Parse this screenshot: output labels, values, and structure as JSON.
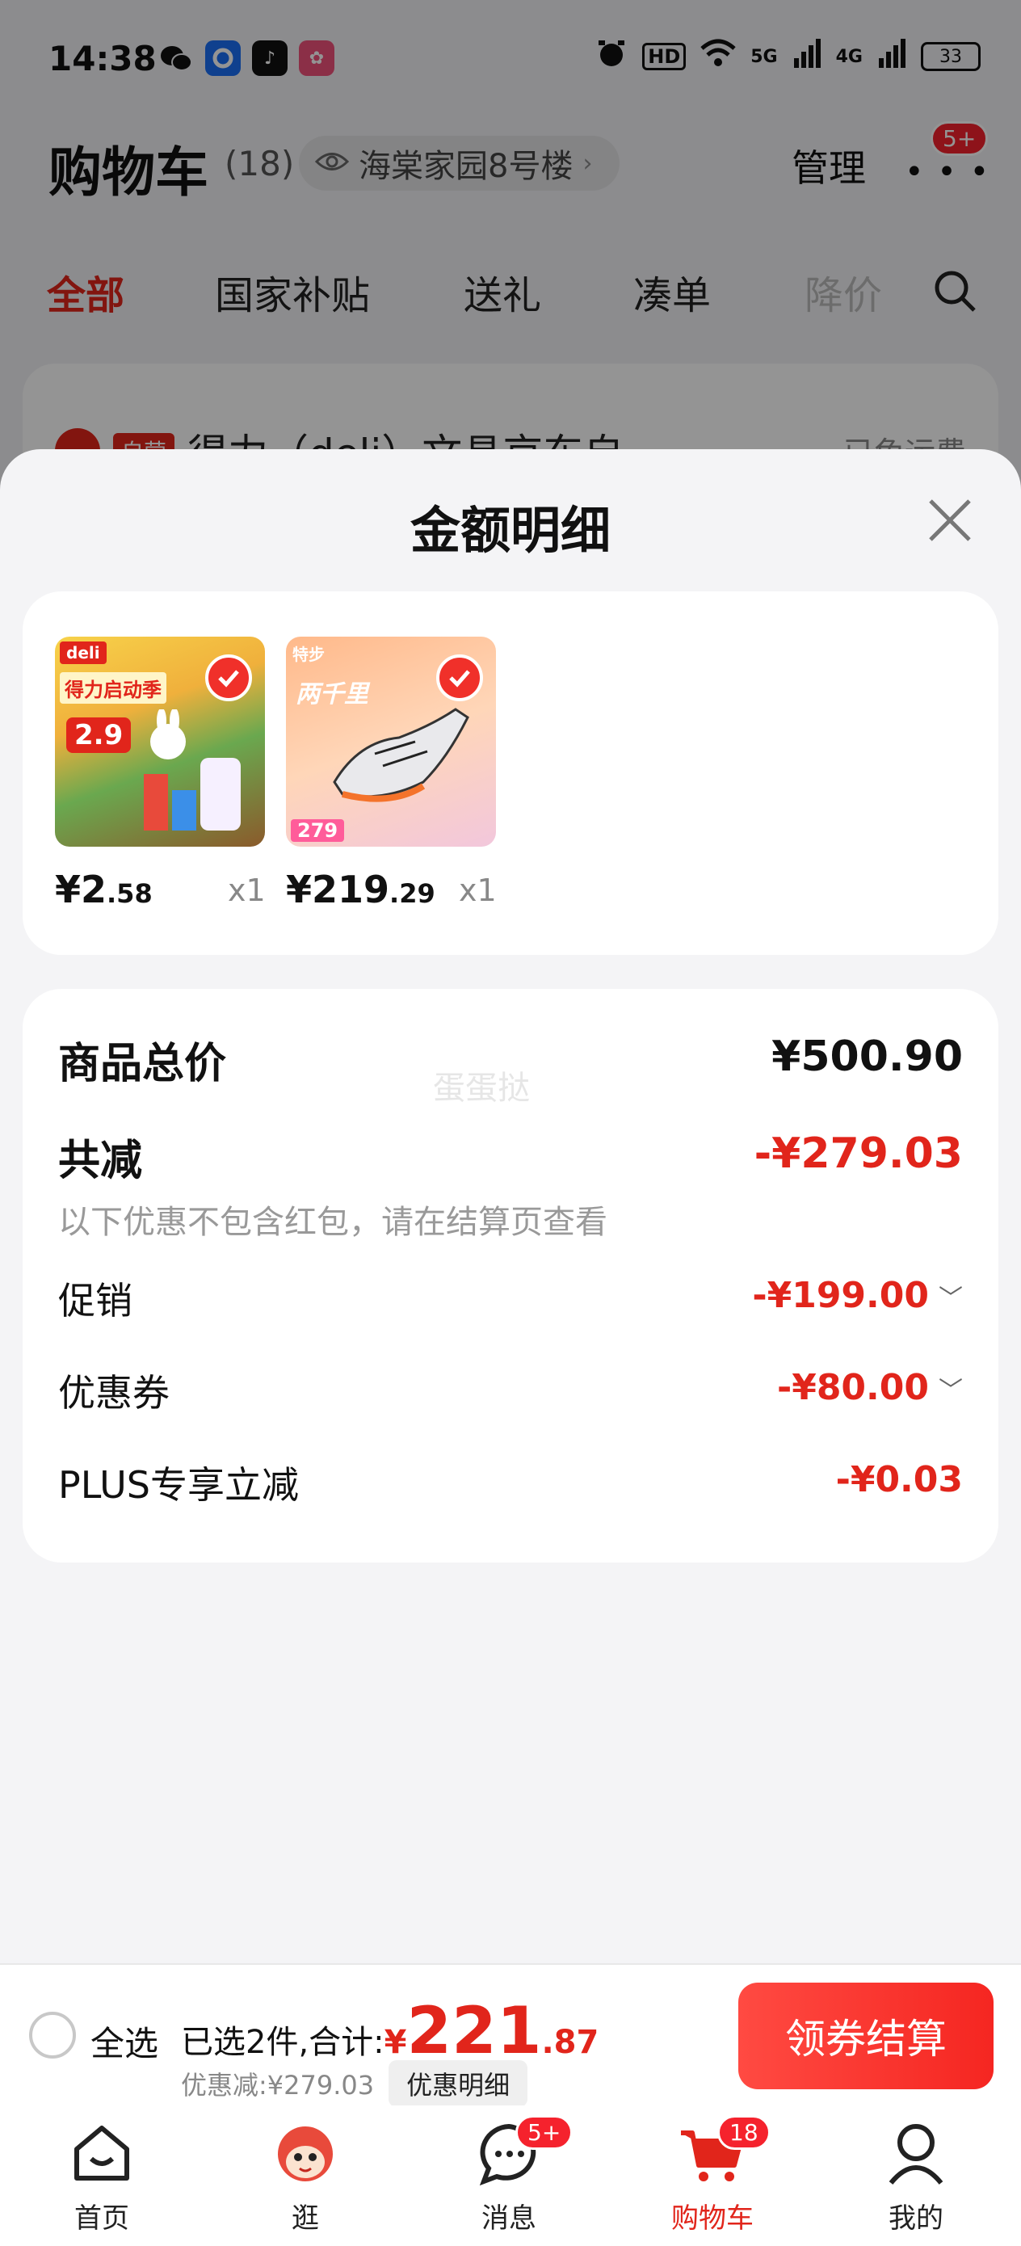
{
  "status_bar": {
    "time": "14:38",
    "battery": "33",
    "net1": "5G",
    "net2": "4G",
    "hd": "HD"
  },
  "header": {
    "title": "购物车",
    "count": "(18)",
    "address": "海棠家园8号楼",
    "manage": "管理",
    "more_badge": "5+"
  },
  "tabs": [
    "全部",
    "国家补贴",
    "送礼",
    "凑单",
    "降价"
  ],
  "shop_preview": {
    "tag": "自营",
    "name": "得力（deli）文具京东自",
    "freight": "已免运费"
  },
  "sheet": {
    "title": "金额明细",
    "watermark": "蛋蛋挞",
    "goods": [
      {
        "price_int": "¥2",
        "price_dec": ".58",
        "qty": "x1",
        "img_brand": "deli",
        "img_text": "得力启动季",
        "img_price": "2.9"
      },
      {
        "price_int": "¥219",
        "price_dec": ".29",
        "qty": "x1",
        "img_brand": "特步",
        "img_text": "两千里",
        "img_price": "279"
      }
    ],
    "total_label": "商品总价",
    "total_value": "¥500.90",
    "reduce_label": "共减",
    "reduce_value": "-¥279.03",
    "reduce_note": "以下优惠不包含红包，请在结算页查看",
    "items": [
      {
        "label": "促销",
        "value": "-¥199.00"
      },
      {
        "label": "优惠券",
        "value": "-¥80.00"
      },
      {
        "label": "PLUS专享立减",
        "value": "-¥0.03"
      }
    ]
  },
  "checkout": {
    "select_all": "全选",
    "selected_text": "已选2件,合计:",
    "yen": "¥",
    "total_int": "221",
    "total_dec": ".87",
    "discount_text": "优惠减:¥279.03",
    "discount_detail": "优惠明细",
    "pay_button": "领券结算"
  },
  "tabbar": [
    {
      "label": "首页",
      "icon": "home-icon"
    },
    {
      "label": "逛",
      "icon": "mascot-icon"
    },
    {
      "label": "消息",
      "icon": "message-icon",
      "badge": "5+"
    },
    {
      "label": "购物车",
      "icon": "cart-icon",
      "badge": "18"
    },
    {
      "label": "我的",
      "icon": "profile-icon"
    }
  ],
  "colors": {
    "accent": "#e1251b",
    "background": "#f4f4f6"
  }
}
